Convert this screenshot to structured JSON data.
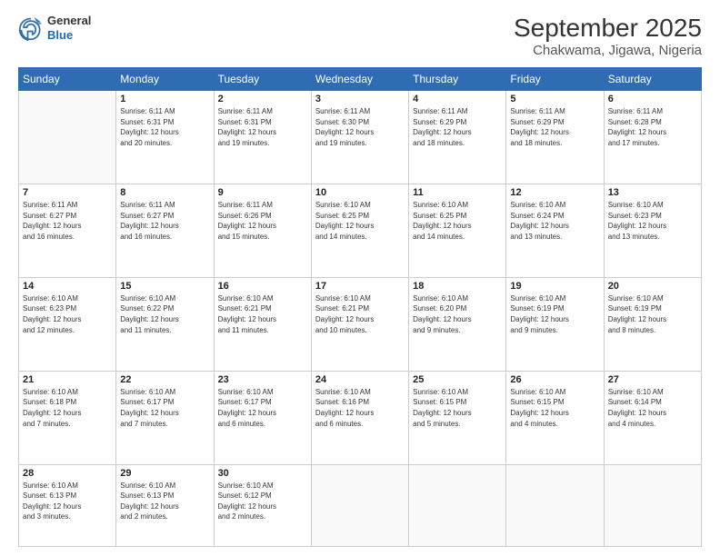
{
  "header": {
    "logo_general": "General",
    "logo_blue": "Blue",
    "month_title": "September 2025",
    "location": "Chakwama, Jigawa, Nigeria"
  },
  "weekdays": [
    "Sunday",
    "Monday",
    "Tuesday",
    "Wednesday",
    "Thursday",
    "Friday",
    "Saturday"
  ],
  "weeks": [
    [
      {
        "day": "",
        "info": ""
      },
      {
        "day": "1",
        "info": "Sunrise: 6:11 AM\nSunset: 6:31 PM\nDaylight: 12 hours\nand 20 minutes."
      },
      {
        "day": "2",
        "info": "Sunrise: 6:11 AM\nSunset: 6:31 PM\nDaylight: 12 hours\nand 19 minutes."
      },
      {
        "day": "3",
        "info": "Sunrise: 6:11 AM\nSunset: 6:30 PM\nDaylight: 12 hours\nand 19 minutes."
      },
      {
        "day": "4",
        "info": "Sunrise: 6:11 AM\nSunset: 6:29 PM\nDaylight: 12 hours\nand 18 minutes."
      },
      {
        "day": "5",
        "info": "Sunrise: 6:11 AM\nSunset: 6:29 PM\nDaylight: 12 hours\nand 18 minutes."
      },
      {
        "day": "6",
        "info": "Sunrise: 6:11 AM\nSunset: 6:28 PM\nDaylight: 12 hours\nand 17 minutes."
      }
    ],
    [
      {
        "day": "7",
        "info": "Sunrise: 6:11 AM\nSunset: 6:27 PM\nDaylight: 12 hours\nand 16 minutes."
      },
      {
        "day": "8",
        "info": "Sunrise: 6:11 AM\nSunset: 6:27 PM\nDaylight: 12 hours\nand 16 minutes."
      },
      {
        "day": "9",
        "info": "Sunrise: 6:11 AM\nSunset: 6:26 PM\nDaylight: 12 hours\nand 15 minutes."
      },
      {
        "day": "10",
        "info": "Sunrise: 6:10 AM\nSunset: 6:25 PM\nDaylight: 12 hours\nand 14 minutes."
      },
      {
        "day": "11",
        "info": "Sunrise: 6:10 AM\nSunset: 6:25 PM\nDaylight: 12 hours\nand 14 minutes."
      },
      {
        "day": "12",
        "info": "Sunrise: 6:10 AM\nSunset: 6:24 PM\nDaylight: 12 hours\nand 13 minutes."
      },
      {
        "day": "13",
        "info": "Sunrise: 6:10 AM\nSunset: 6:23 PM\nDaylight: 12 hours\nand 13 minutes."
      }
    ],
    [
      {
        "day": "14",
        "info": "Sunrise: 6:10 AM\nSunset: 6:23 PM\nDaylight: 12 hours\nand 12 minutes."
      },
      {
        "day": "15",
        "info": "Sunrise: 6:10 AM\nSunset: 6:22 PM\nDaylight: 12 hours\nand 11 minutes."
      },
      {
        "day": "16",
        "info": "Sunrise: 6:10 AM\nSunset: 6:21 PM\nDaylight: 12 hours\nand 11 minutes."
      },
      {
        "day": "17",
        "info": "Sunrise: 6:10 AM\nSunset: 6:21 PM\nDaylight: 12 hours\nand 10 minutes."
      },
      {
        "day": "18",
        "info": "Sunrise: 6:10 AM\nSunset: 6:20 PM\nDaylight: 12 hours\nand 9 minutes."
      },
      {
        "day": "19",
        "info": "Sunrise: 6:10 AM\nSunset: 6:19 PM\nDaylight: 12 hours\nand 9 minutes."
      },
      {
        "day": "20",
        "info": "Sunrise: 6:10 AM\nSunset: 6:19 PM\nDaylight: 12 hours\nand 8 minutes."
      }
    ],
    [
      {
        "day": "21",
        "info": "Sunrise: 6:10 AM\nSunset: 6:18 PM\nDaylight: 12 hours\nand 7 minutes."
      },
      {
        "day": "22",
        "info": "Sunrise: 6:10 AM\nSunset: 6:17 PM\nDaylight: 12 hours\nand 7 minutes."
      },
      {
        "day": "23",
        "info": "Sunrise: 6:10 AM\nSunset: 6:17 PM\nDaylight: 12 hours\nand 6 minutes."
      },
      {
        "day": "24",
        "info": "Sunrise: 6:10 AM\nSunset: 6:16 PM\nDaylight: 12 hours\nand 6 minutes."
      },
      {
        "day": "25",
        "info": "Sunrise: 6:10 AM\nSunset: 6:15 PM\nDaylight: 12 hours\nand 5 minutes."
      },
      {
        "day": "26",
        "info": "Sunrise: 6:10 AM\nSunset: 6:15 PM\nDaylight: 12 hours\nand 4 minutes."
      },
      {
        "day": "27",
        "info": "Sunrise: 6:10 AM\nSunset: 6:14 PM\nDaylight: 12 hours\nand 4 minutes."
      }
    ],
    [
      {
        "day": "28",
        "info": "Sunrise: 6:10 AM\nSunset: 6:13 PM\nDaylight: 12 hours\nand 3 minutes."
      },
      {
        "day": "29",
        "info": "Sunrise: 6:10 AM\nSunset: 6:13 PM\nDaylight: 12 hours\nand 2 minutes."
      },
      {
        "day": "30",
        "info": "Sunrise: 6:10 AM\nSunset: 6:12 PM\nDaylight: 12 hours\nand 2 minutes."
      },
      {
        "day": "",
        "info": ""
      },
      {
        "day": "",
        "info": ""
      },
      {
        "day": "",
        "info": ""
      },
      {
        "day": "",
        "info": ""
      }
    ]
  ]
}
